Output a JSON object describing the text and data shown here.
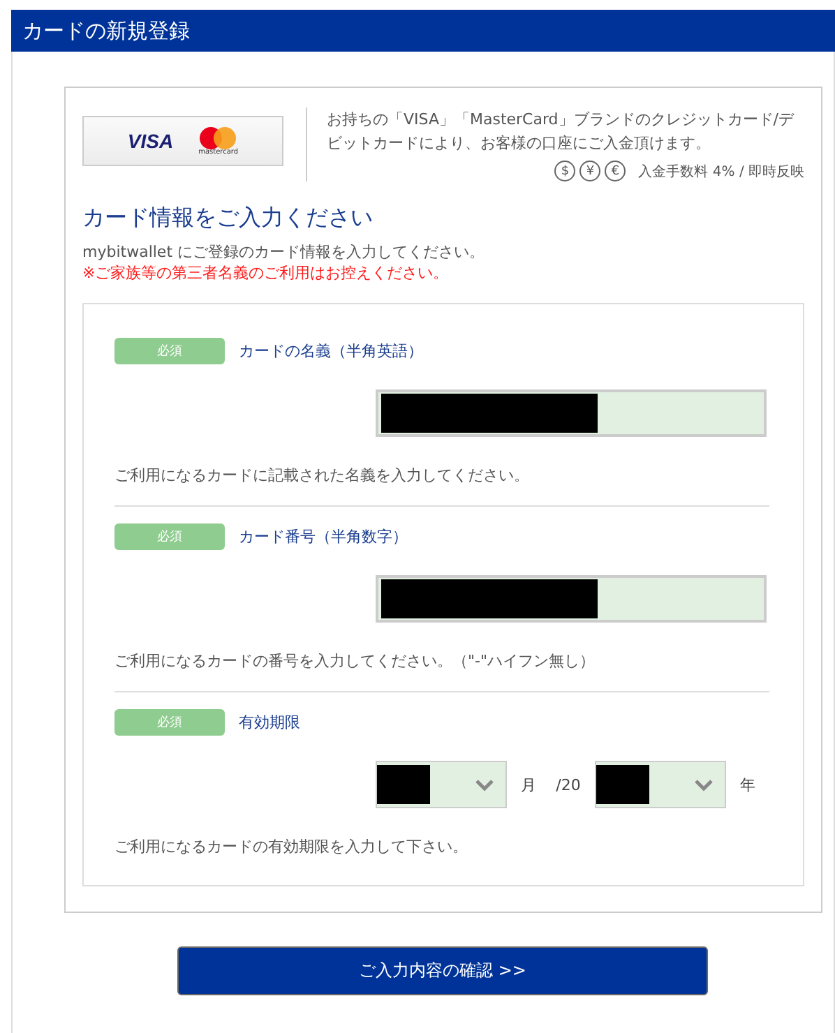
{
  "header": {
    "title": "カードの新規登録"
  },
  "brands": {
    "visa": "VISA",
    "mastercard": "mastercard"
  },
  "intro": {
    "text": "お持ちの「VISA」「MasterCard」ブランドのクレジットカード/デビットカードにより、お客様の口座にご入金頂けます。",
    "currencies": [
      "$",
      "¥",
      "€"
    ],
    "fee": "入金手数料 4% / 即時反映"
  },
  "heading": "カード情報をご入力ください",
  "note": "mybitwallet にご登録のカード情報を入力してください。",
  "warning": "※ご家族等の第三者名義のご利用はお控えください。",
  "fields": [
    {
      "kind": "text",
      "badge": "必須",
      "label": "カードの名義（半角英語）",
      "redacted": true,
      "help": "ご利用になるカードに記載された名義を入力してください。"
    },
    {
      "kind": "text",
      "badge": "必須",
      "label": "カード番号（半角数字）",
      "redacted": true,
      "help": "ご利用になるカードの番号を入力してください。（\"-\"ハイフン無し）"
    },
    {
      "kind": "expiry",
      "badge": "必須",
      "label": "有効期限",
      "month_unit": "月",
      "year_prefix": "/20",
      "year_unit": "年",
      "redacted": true,
      "help": "ご利用になるカードの有効期限を入力して下さい。"
    }
  ],
  "button": "ご入力内容の確認 >>"
}
